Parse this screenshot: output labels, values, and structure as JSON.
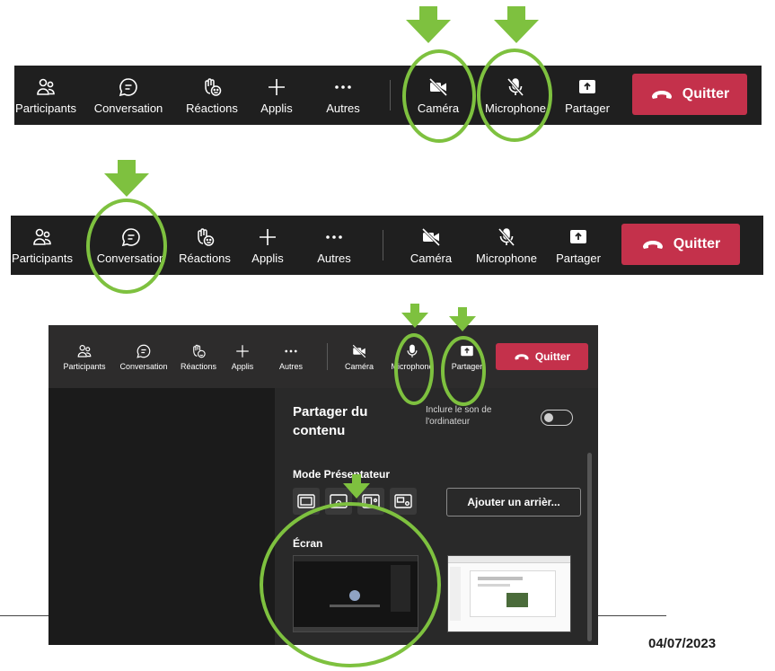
{
  "colors": {
    "accent_green": "#7ec13f",
    "quit_red": "#c4314b",
    "toolbar_bg": "#1f1f1f"
  },
  "toolbar_top": {
    "participants": "Participants",
    "conversation": "Conversation",
    "reactions": "Réactions",
    "apps": "Applis",
    "more": "Autres",
    "camera": "Caméra",
    "microphone": "Microphone",
    "share": "Partager",
    "quit": "Quitter"
  },
  "toolbar_middle": {
    "participants": "Participants",
    "conversation": "Conversation",
    "reactions": "Réactions",
    "apps": "Applis",
    "more": "Autres",
    "camera": "Caméra",
    "microphone": "Microphone",
    "share": "Partager",
    "quit": "Quitter"
  },
  "meeting_panel": {
    "toolbar": {
      "participants": "Participants",
      "conversation": "Conversation",
      "reactions": "Réactions",
      "apps": "Applis",
      "more": "Autres",
      "camera": "Caméra",
      "microphone": "Microphone",
      "share": "Partager",
      "quit": "Quitter"
    },
    "share_panel": {
      "title": "Partager du contenu",
      "include_sound": "Inclure le son de l'ordinateur",
      "presenter_mode": "Mode Présentateur",
      "add_background": "Ajouter un arrièr...",
      "screen_section": "Écran"
    }
  },
  "footer": {
    "date": "04/07/2023"
  }
}
